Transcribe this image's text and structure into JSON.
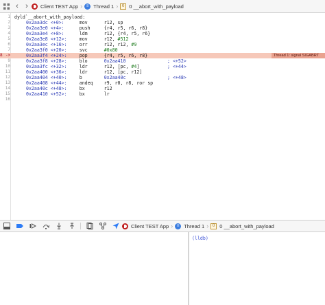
{
  "jumpbar": {
    "app_label": "Client TEST App",
    "thread_label": "Thread 1",
    "frame_label": "0 __abort_with_payload",
    "frame_index": "0"
  },
  "editor": {
    "lines": [
      {
        "n": "1",
        "addr": "",
        "off": "",
        "op": "",
        "args": "",
        "comment": "",
        "header": "dyld`__abort_with_payload:"
      },
      {
        "n": "2",
        "addr": "0x2aa3dc",
        "off": "<+0>:",
        "op": "mov",
        "args": "r12, sp",
        "comment": ""
      },
      {
        "n": "3",
        "addr": "0x2aa3e0",
        "off": "<+4>:",
        "op": "push",
        "args": "{r4, r5, r6, r8}",
        "comment": ""
      },
      {
        "n": "4",
        "addr": "0x2aa3e4",
        "off": "<+8>:",
        "op": "ldm",
        "args": "r12, {r4, r5, r6}",
        "comment": ""
      },
      {
        "n": "5",
        "addr": "0x2aa3e8",
        "off": "<+12>:",
        "op": "mov",
        "args": "r12, #512",
        "comment": ""
      },
      {
        "n": "6",
        "addr": "0x2aa3ec",
        "off": "<+16>:",
        "op": "orr",
        "args": "r12, r12, #9",
        "comment": ""
      },
      {
        "n": "7",
        "addr": "0x2aa3f0",
        "off": "<+20>:",
        "op": "svc",
        "args": "#0x80",
        "comment": ""
      },
      {
        "n": "8",
        "addr": "0x2aa3f4",
        "off": "<+24>:",
        "op": "pop",
        "args": "{r4, r5, r6, r8}",
        "comment": "",
        "current": true,
        "marker": "->"
      },
      {
        "n": "9",
        "addr": "0x2aa3f8",
        "off": "<+28>:",
        "op": "blo",
        "args": "0x2aa410",
        "comment": "; <+52>"
      },
      {
        "n": "10",
        "addr": "0x2aa3fc",
        "off": "<+32>:",
        "op": "ldr",
        "args": "r12, [pc, #4]",
        "comment": "; <+44>"
      },
      {
        "n": "11",
        "addr": "0x2aa400",
        "off": "<+36>:",
        "op": "ldr",
        "args": "r12, [pc, r12]",
        "comment": ""
      },
      {
        "n": "12",
        "addr": "0x2aa404",
        "off": "<+40>:",
        "op": "b",
        "args": "0x2aa40c",
        "comment": "; <+48>"
      },
      {
        "n": "13",
        "addr": "0x2aa408",
        "off": "<+44>:",
        "op": "andeq",
        "args": "r9, r0, r8, ror sp",
        "comment": ""
      },
      {
        "n": "14",
        "addr": "0x2aa40c",
        "off": "<+48>:",
        "op": "bx",
        "args": "r12",
        "comment": ""
      },
      {
        "n": "15",
        "addr": "0x2aa410",
        "off": "<+52>:",
        "op": "bx",
        "args": "lr",
        "comment": ""
      },
      {
        "n": "16",
        "addr": "",
        "off": "",
        "op": "",
        "args": "",
        "comment": ""
      }
    ],
    "signal_badge": "Thread 1: signal SIGABRT"
  },
  "debugbar": {
    "app_label": "Client TEST App",
    "thread_label": "Thread 1",
    "frame_label": "0 __abort_with_payload",
    "frame_index": "0"
  },
  "console": {
    "prompt": "(lldb)"
  },
  "colors": {
    "current_line_bg": "#f6c8b9",
    "badge_bg": "#e9a28f",
    "address_blue": "#2a3ab5",
    "literal_green": "#1b7a1b",
    "breakpoint_blue": "#2d7cf6"
  }
}
